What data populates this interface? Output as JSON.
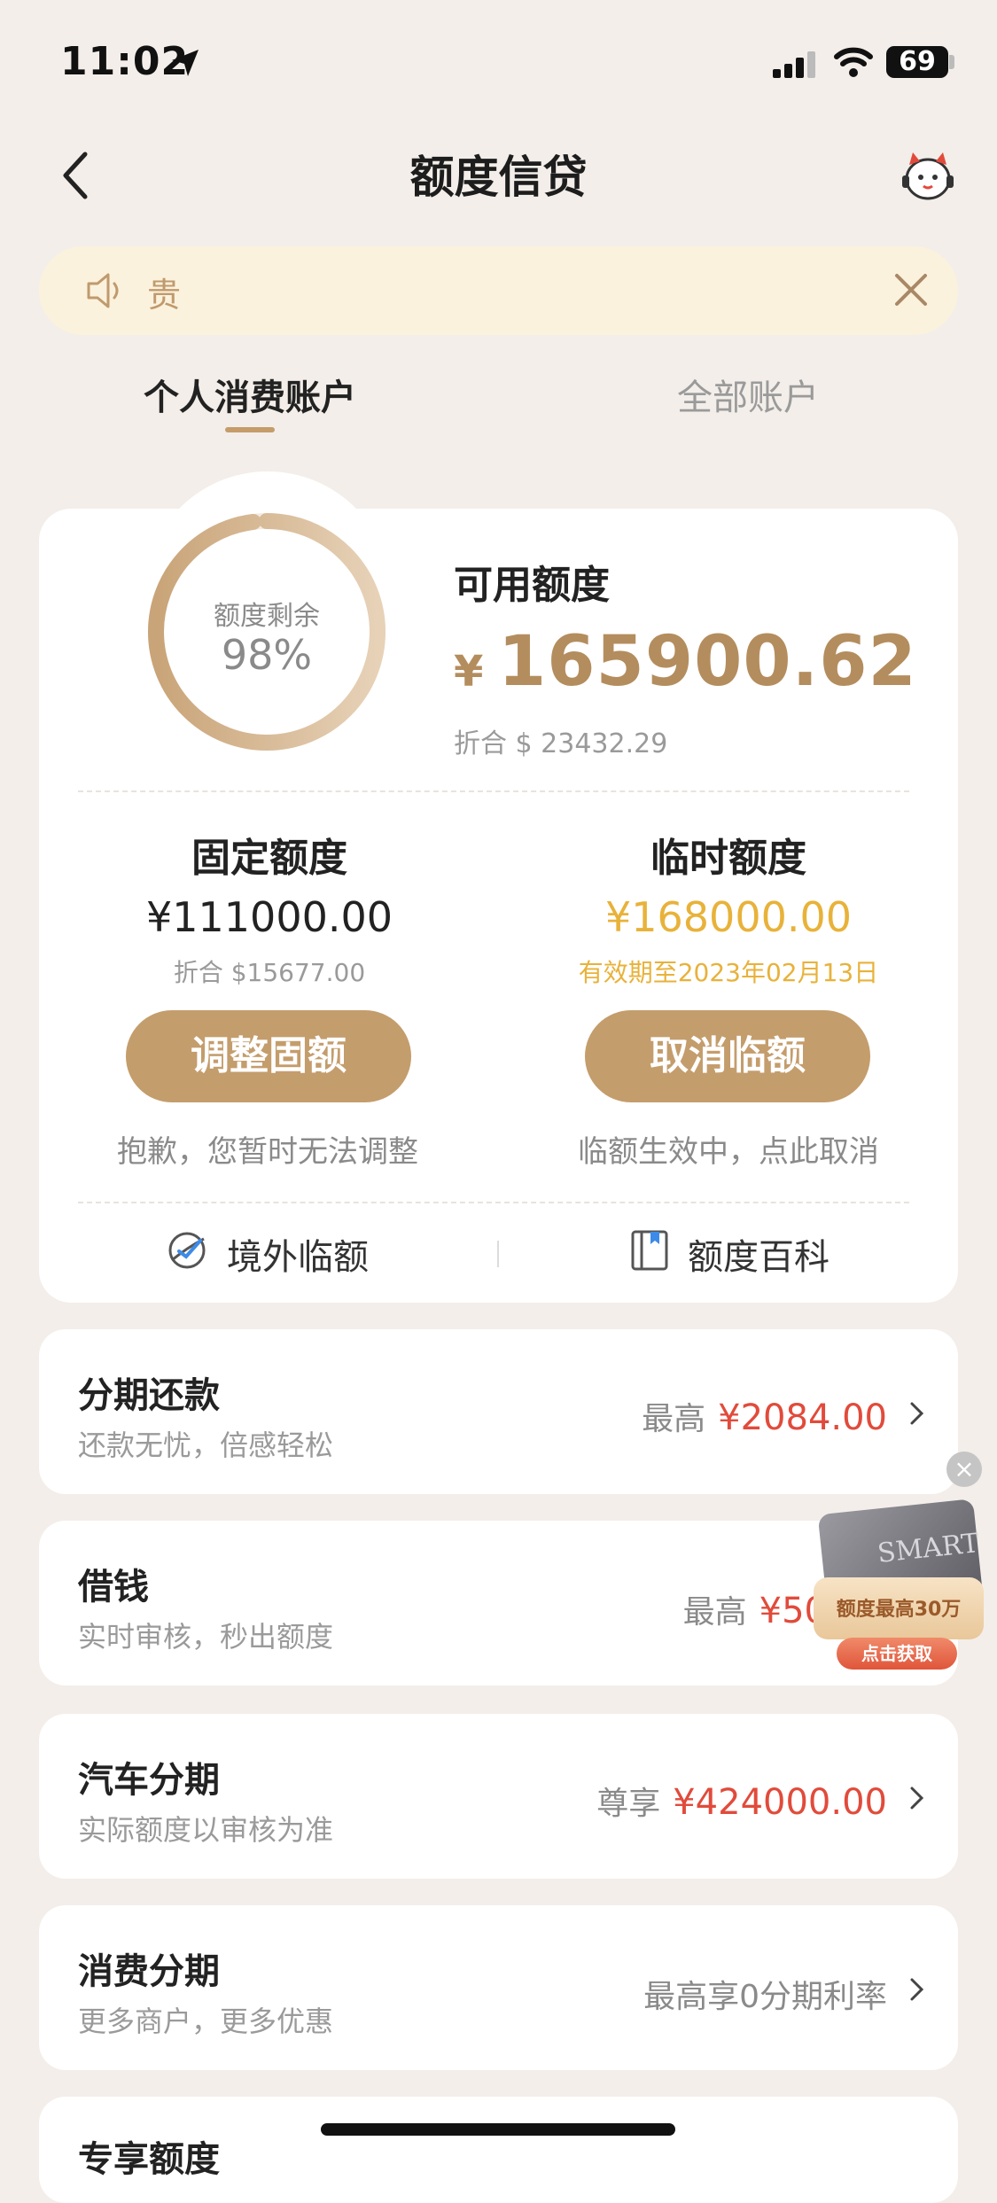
{
  "status_bar": {
    "time": "11:02",
    "battery": "69"
  },
  "nav": {
    "title": "额度信贷"
  },
  "notice": {
    "text": "贵"
  },
  "tabs": [
    {
      "label": "个人消费账户",
      "active": true
    },
    {
      "label": "全部账户",
      "active": false
    }
  ],
  "credit": {
    "ring_label": "额度剩余",
    "ring_percent": "98%",
    "ring_fraction": 0.98,
    "available_label": "可用额度",
    "currency_symbol": "¥",
    "available_amount": "165900.62",
    "available_converted": "折合 $ 23432.29"
  },
  "fixed": {
    "title": "固定额度",
    "amount": "¥111000.00",
    "converted": "折合 $15677.00",
    "button": "调整固额",
    "hint": "抱歉，您暂时无法调整"
  },
  "temporary": {
    "title": "临时额度",
    "amount": "¥168000.00",
    "validity": "有效期至2023年02月13日",
    "button": "取消临额",
    "hint": "临额生效中，点此取消"
  },
  "links": [
    {
      "label": "境外临额",
      "icon": "overseas-icon"
    },
    {
      "label": "额度百科",
      "icon": "book-icon"
    }
  ],
  "services": [
    {
      "title": "分期还款",
      "subtitle": "还款无忧，倍感轻松",
      "prefix": "最高",
      "amount": "¥2084.00"
    },
    {
      "title": "借钱",
      "subtitle": "实时审核，秒出额度",
      "prefix": "最高",
      "amount": "¥50"
    },
    {
      "title": "汽车分期",
      "subtitle": "实际额度以审核为准",
      "prefix": "尊享",
      "amount": "¥424000.00"
    },
    {
      "title": "消费分期",
      "subtitle": "更多商户，更多优惠",
      "prefix": "最高享0分期利率",
      "amount": ""
    },
    {
      "title": "专享额度",
      "subtitle": "",
      "prefix": "",
      "amount": ""
    }
  ],
  "promo": {
    "card_text": "SMART",
    "headline": "额度最高30万",
    "button": "点击获取"
  },
  "colors": {
    "accent": "#c49d6c",
    "gold_text": "#b48d5e",
    "temp_amount": "#e8b23a",
    "red": "#e14b3b"
  }
}
